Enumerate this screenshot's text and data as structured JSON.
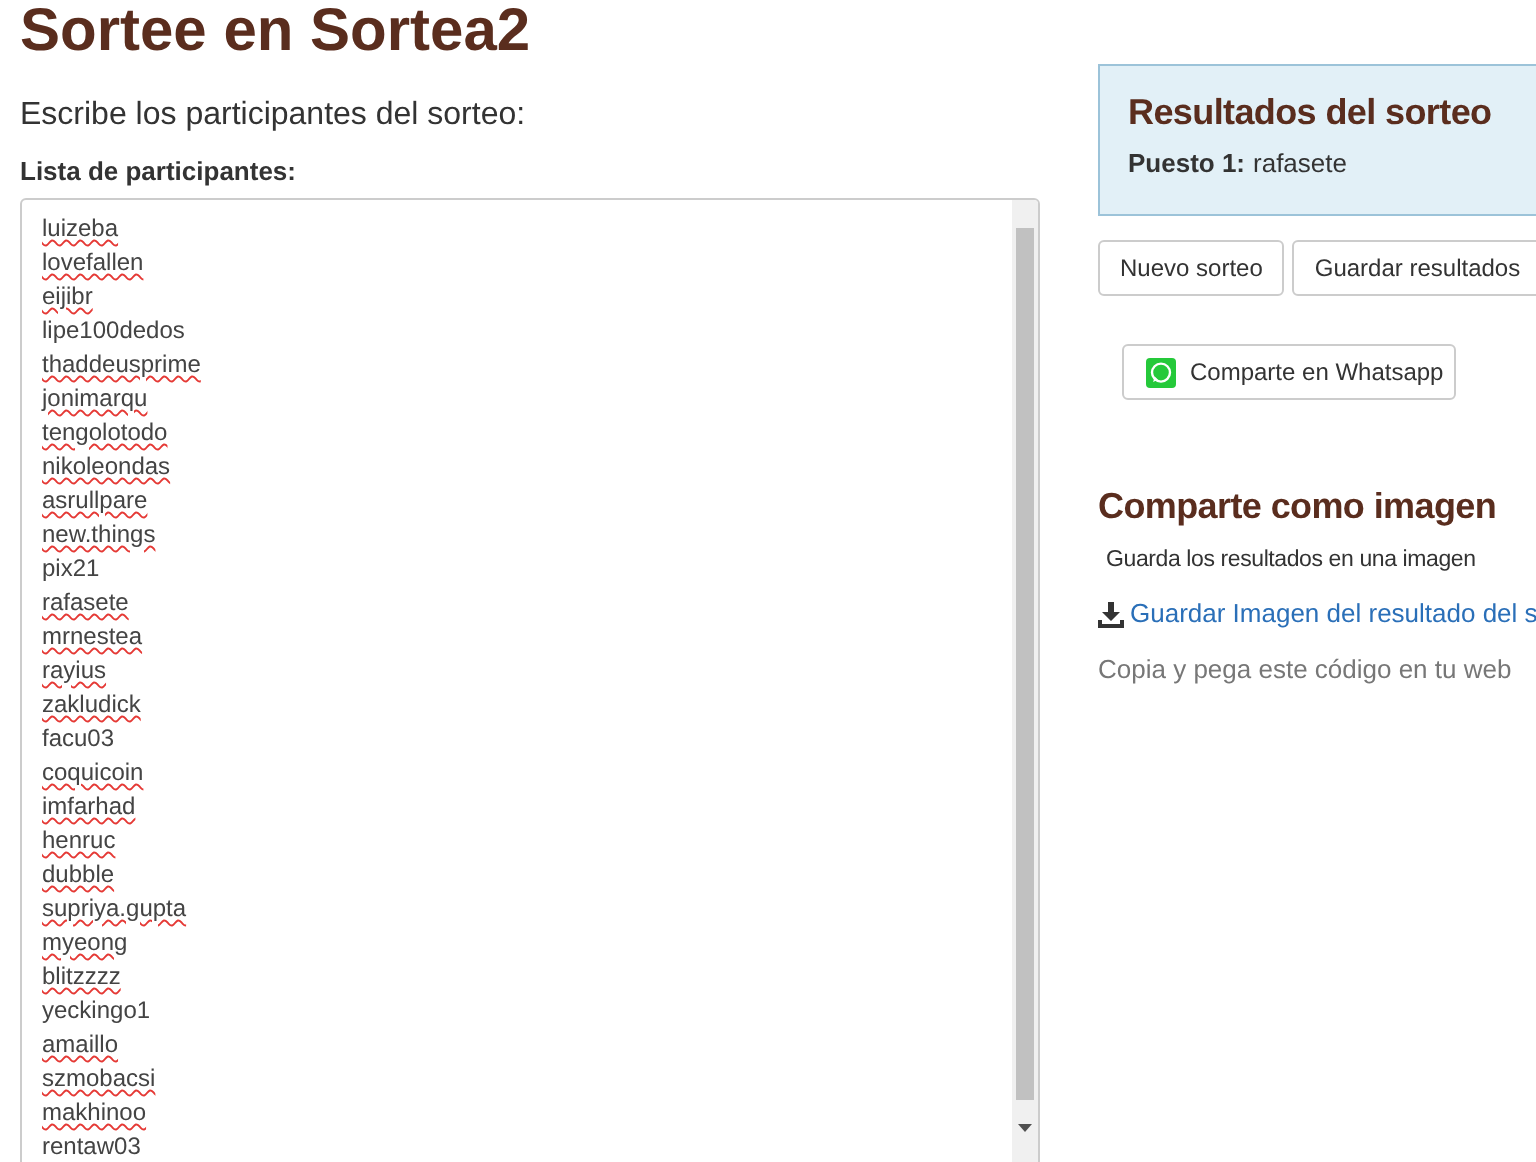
{
  "page_title": "Sortee en Sortea2",
  "form": {
    "heading": "Escribe los participantes del sorteo:",
    "list_label": "Lista de participantes:",
    "participants": [
      {
        "name": "luizeba",
        "misspelled": true
      },
      {
        "name": "lovefallen",
        "misspelled": true
      },
      {
        "name": "eijibr",
        "misspelled": true
      },
      {
        "name": "lipe100dedos",
        "misspelled": false
      },
      {
        "name": "thaddeusprime",
        "misspelled": true
      },
      {
        "name": "jonimarqu",
        "misspelled": true
      },
      {
        "name": "tengolotodo",
        "misspelled": true
      },
      {
        "name": "nikoleondas",
        "misspelled": true
      },
      {
        "name": "asrullpare",
        "misspelled": true
      },
      {
        "name": "new.things",
        "misspelled": true
      },
      {
        "name": "pix21",
        "misspelled": false
      },
      {
        "name": "rafasete",
        "misspelled": true
      },
      {
        "name": "mrnestea",
        "misspelled": true
      },
      {
        "name": "rayius",
        "misspelled": true
      },
      {
        "name": "zakludick",
        "misspelled": true
      },
      {
        "name": "facu03",
        "misspelled": false
      },
      {
        "name": "coquicoin",
        "misspelled": true
      },
      {
        "name": "imfarhad",
        "misspelled": true
      },
      {
        "name": "henruc",
        "misspelled": true
      },
      {
        "name": "dubble",
        "misspelled": true
      },
      {
        "name": "supriya.gupta",
        "misspelled": true
      },
      {
        "name": "myeong",
        "misspelled": true
      },
      {
        "name": "blitzzzz",
        "misspelled": true
      },
      {
        "name": "yeckingo1",
        "misspelled": false
      },
      {
        "name": "amaillo",
        "misspelled": true
      },
      {
        "name": "szmobacsi",
        "misspelled": true
      },
      {
        "name": "makhinoo",
        "misspelled": true
      },
      {
        "name": "rentaw03",
        "misspelled": false
      }
    ]
  },
  "results": {
    "title": "Resultados del sorteo",
    "winners": [
      {
        "label": "Puesto 1:",
        "name": "rafasete"
      }
    ]
  },
  "buttons": [
    "Nuevo sorteo",
    "Guardar resultados"
  ],
  "whatsapp_button": "Comparte en Whatsapp",
  "share_image": {
    "heading": "Comparte como imagen",
    "description": "Guarda los resultados en una imagen",
    "download_link": "Guardar Imagen del resultado del s",
    "embed_hint": "Copia y pega este código en tu web"
  }
}
